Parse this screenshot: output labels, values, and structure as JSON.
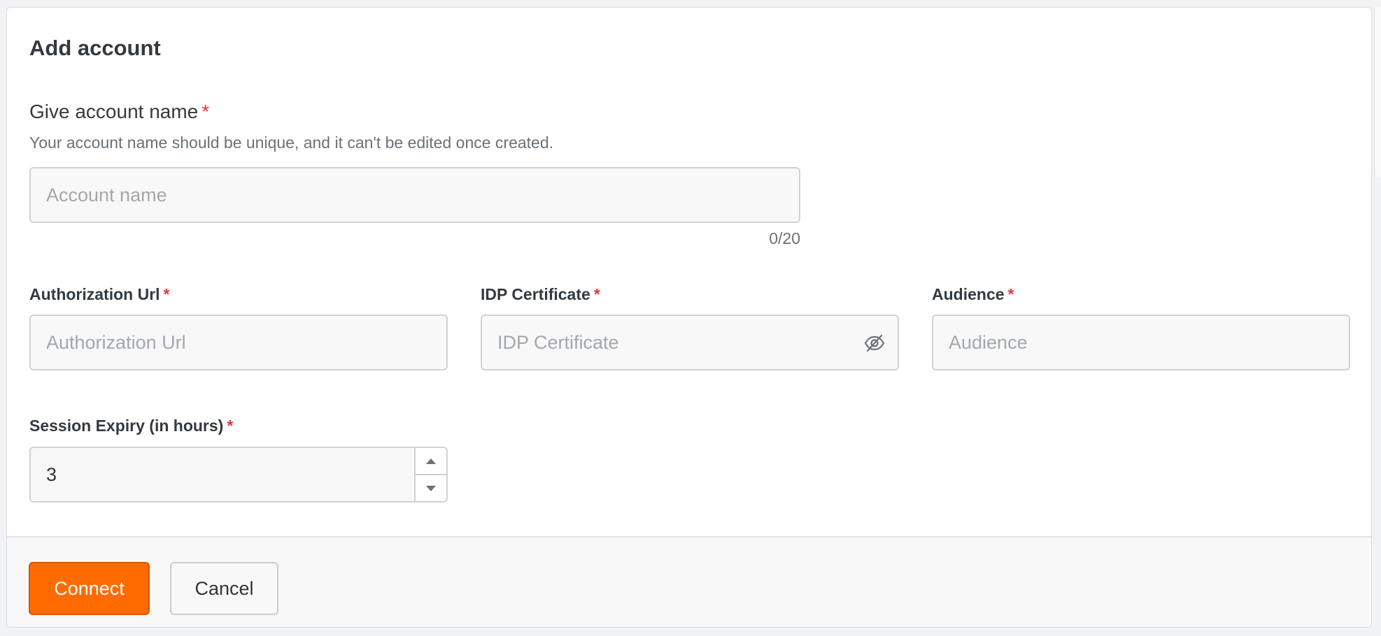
{
  "dialog": {
    "title": "Add account"
  },
  "account_name": {
    "label": "Give account name",
    "required_mark": "*",
    "help_text": "Your account name should be unique, and it can't be edited once created.",
    "placeholder": "Account name",
    "value": "",
    "counter": "0/20"
  },
  "authorization_url": {
    "label": "Authorization Url",
    "required_mark": "*",
    "placeholder": "Authorization Url",
    "value": ""
  },
  "idp_certificate": {
    "label": "IDP Certificate",
    "required_mark": "*",
    "placeholder": "IDP Certificate",
    "value": "",
    "toggle_icon": "eye-off-icon"
  },
  "audience": {
    "label": "Audience",
    "required_mark": "*",
    "placeholder": "Audience",
    "value": ""
  },
  "session_expiry": {
    "label": "Session Expiry (in hours)",
    "required_mark": "*",
    "value": "3",
    "increment_icon": "caret-up-icon",
    "decrement_icon": "caret-down-icon"
  },
  "footer": {
    "connect_label": "Connect",
    "cancel_label": "Cancel"
  },
  "colors": {
    "primary": "#ff6b00",
    "required": "#e53935"
  }
}
